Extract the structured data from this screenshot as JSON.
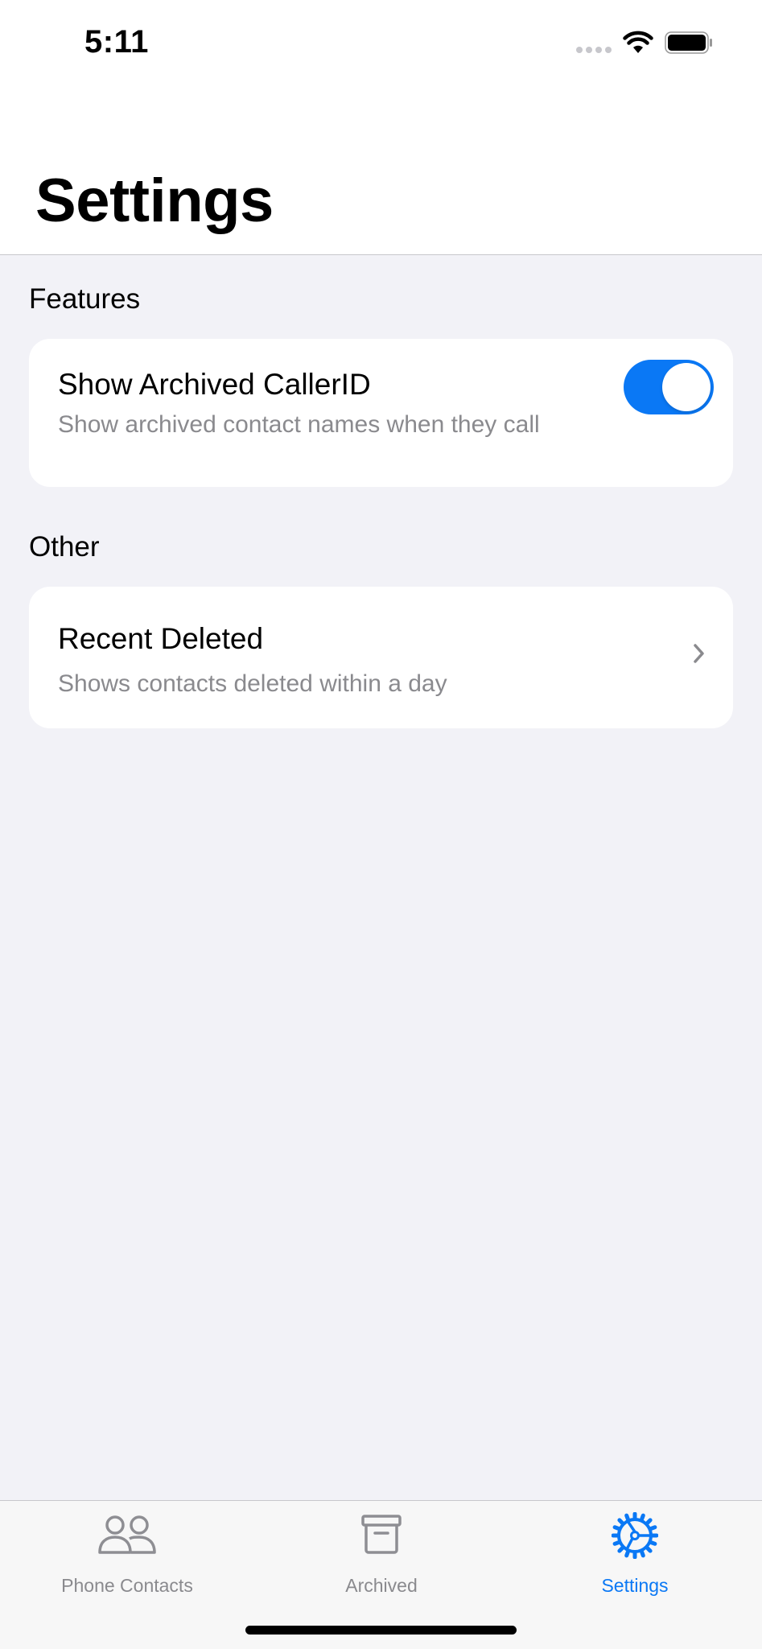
{
  "status_bar": {
    "time": "5:11"
  },
  "header": {
    "title": "Settings"
  },
  "sections": [
    {
      "header": "Features",
      "rows": [
        {
          "title": "Show Archived CallerID",
          "subtitle": "Show archived contact names when they call",
          "control": "toggle",
          "toggle_on": true
        }
      ]
    },
    {
      "header": "Other",
      "rows": [
        {
          "title": "Recent Deleted",
          "subtitle": "Shows contacts deleted within a day",
          "control": "chevron"
        }
      ]
    }
  ],
  "tab_bar": {
    "tabs": [
      {
        "label": "Phone Contacts",
        "icon": "person-2-icon",
        "active": false
      },
      {
        "label": "Archived",
        "icon": "archive-box-icon",
        "active": false
      },
      {
        "label": "Settings",
        "icon": "gear-icon",
        "active": true
      }
    ]
  },
  "colors": {
    "accent": "#0a78f5",
    "background": "#f2f2f7",
    "secondary_text": "#8a8a8e",
    "inactive_icon": "#8e8e93"
  }
}
